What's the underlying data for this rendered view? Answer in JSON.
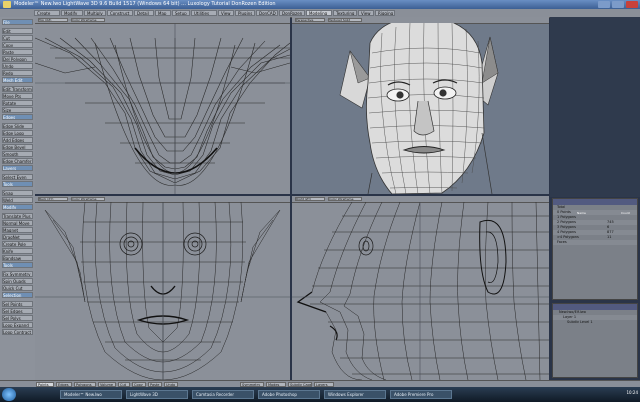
{
  "window": {
    "title": "Modeler™ New.lwo LightWave 3D 9.6 Build 1517 (Windows 64 bit) ... Luxology Tutorial DonRozen Edition"
  },
  "menu_tabs": [
    "Create",
    "Modify",
    "Multiply",
    "Construct",
    "Detail",
    "Map",
    "Setup",
    "Utilities",
    "View",
    "Plugins",
    "DonCAD",
    "DonRozen",
    "Modeling",
    "Texturing",
    "View",
    "Rigging"
  ],
  "active_tab_index": 12,
  "toolbar": {
    "items": [
      {
        "label": "File",
        "head": true
      },
      {
        "label": "Edit",
        "head": false
      },
      {
        "label": "Cut",
        "head": false
      },
      {
        "label": "Copy",
        "head": false
      },
      {
        "label": "Paste",
        "head": false
      },
      {
        "label": "Del Polygon",
        "head": false
      },
      {
        "label": "Undo",
        "head": false
      },
      {
        "label": "Redo",
        "head": false
      },
      {
        "label": "Mesh Edit",
        "head": true
      },
      {
        "label": "Edit Transform",
        "head": false
      },
      {
        "label": "Move Pts",
        "head": false
      },
      {
        "label": "Rotate",
        "head": false
      },
      {
        "label": "Size",
        "head": false
      },
      {
        "label": "Edges",
        "head": true
      },
      {
        "label": "Edge Slide",
        "head": false
      },
      {
        "label": "Edge Loop",
        "head": false
      },
      {
        "label": "Add Edges",
        "head": false
      },
      {
        "label": "Edge Bevel",
        "head": false
      },
      {
        "label": "Smooth",
        "head": false
      },
      {
        "label": "Edge Chamfer",
        "head": false
      },
      {
        "label": "Layers",
        "head": true
      },
      {
        "label": "Select Even",
        "head": false
      },
      {
        "label": "Tools",
        "head": true
      },
      {
        "label": "Snap",
        "head": false
      },
      {
        "label": "Weld",
        "head": false
      },
      {
        "label": "Modify",
        "head": true
      },
      {
        "label": "Translate Plus",
        "head": false
      },
      {
        "label": "Normal Move",
        "head": false
      },
      {
        "label": "Magnet",
        "head": false
      },
      {
        "label": "DragNet",
        "head": false
      },
      {
        "label": "Create Pole",
        "head": false
      },
      {
        "label": "Knife",
        "head": false
      },
      {
        "label": "Bandsaw",
        "head": false
      },
      {
        "label": "Tools",
        "head": true
      },
      {
        "label": "Fix Symmetry",
        "head": false
      },
      {
        "label": "Spin Quads",
        "head": false
      },
      {
        "label": "Quick Cut",
        "head": false
      },
      {
        "label": "Selection",
        "head": true
      },
      {
        "label": "Sel Points",
        "head": false
      },
      {
        "label": "Sel Edges",
        "head": false
      },
      {
        "label": "Sel Polys",
        "head": false
      },
      {
        "label": "Loop Expand",
        "head": false
      },
      {
        "label": "Loop Contract",
        "head": false
      }
    ]
  },
  "viewports": {
    "top_left": {
      "view": "Top (XZ)",
      "mode": "Color Wireframe"
    },
    "top_right": {
      "view": "Perspective",
      "mode": "Textured Solid"
    },
    "bottom_left": {
      "view": "Back (XY)",
      "mode": "Color Wireframe"
    },
    "bottom_right": {
      "view": "Right (ZY)",
      "mode": "Color Wireframe"
    }
  },
  "stats_panel": {
    "header_cols": [
      "Name",
      "Count"
    ],
    "rows": [
      {
        "name": "Total",
        "count": ""
      },
      {
        "name": "0 Points",
        "count": ""
      },
      {
        "name": "1 Polygons",
        "count": ""
      },
      {
        "name": "2 Polygons",
        "count": "745"
      },
      {
        "name": "3 Polygons",
        "count": "6"
      },
      {
        "name": "4 Polygons",
        "count": "877"
      },
      {
        "name": ">4 Polygons",
        "count": "11"
      },
      {
        "name": "Faces",
        "count": ""
      }
    ]
  },
  "layers_panel": {
    "rows": [
      "New.lwo/Elf.lwo",
      "Layer 1",
      "Subdiv Level 1"
    ]
  },
  "statusbar": {
    "items": [
      "Points",
      "Edges",
      "Polygons",
      "Volume",
      "Cut",
      "Copy",
      "Paste",
      "Undo",
      "Symmetry",
      "Modes",
      "Subdiv Cage",
      "Layers"
    ],
    "active_index": 0
  },
  "taskbar": {
    "tasks": [
      "Modeler™ New.lwo",
      "LightWave 3D",
      "Camtasia Recorder",
      "Adobe Photoshop",
      "Windows Explorer",
      "Adobe Premiere Pro"
    ],
    "clock": "10:24"
  },
  "colors": {
    "viewport_bg": "#8b9099",
    "wire": "#262626",
    "accent": "#525a80"
  }
}
